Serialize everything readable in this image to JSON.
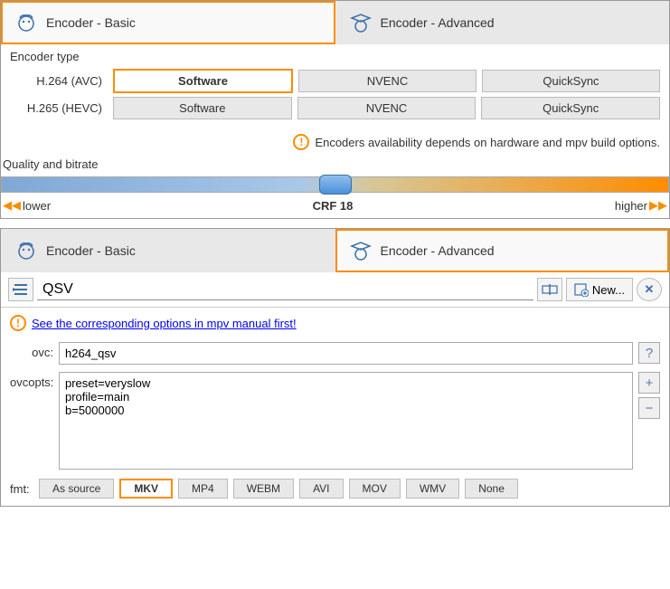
{
  "panel1": {
    "tabs": {
      "basic": "Encoder - Basic",
      "advanced": "Encoder - Advanced"
    },
    "encoderType": {
      "heading": "Encoder type",
      "row1": {
        "label": "H.264 (AVC)",
        "buttons": [
          "Software",
          "NVENC",
          "QuickSync"
        ],
        "active": 0
      },
      "row2": {
        "label": "H.265 (HEVC)",
        "buttons": [
          "Software",
          "NVENC",
          "QuickSync"
        ],
        "active": -1
      }
    },
    "warning": "Encoders availability depends on hardware and mpv build options.",
    "quality": {
      "heading": "Quality and bitrate",
      "lower": "lower",
      "center": "CRF 18",
      "higher": "higher"
    }
  },
  "panel2": {
    "tabs": {
      "basic": "Encoder - Basic",
      "advanced": "Encoder - Advanced"
    },
    "presetName": "QSV",
    "newLabel": "New...",
    "hint": "See the corresponding options in mpv manual first!",
    "ovc": {
      "label": "ovc:",
      "value": "h264_qsv"
    },
    "ovcopts": {
      "label": "ovcopts:",
      "value": "preset=veryslow\nprofile=main\nb=5000000"
    },
    "fmt": {
      "label": "fmt:",
      "buttons": [
        "As source",
        "MKV",
        "MP4",
        "WEBM",
        "AVI",
        "MOV",
        "WMV",
        "None"
      ],
      "active": 1
    }
  }
}
